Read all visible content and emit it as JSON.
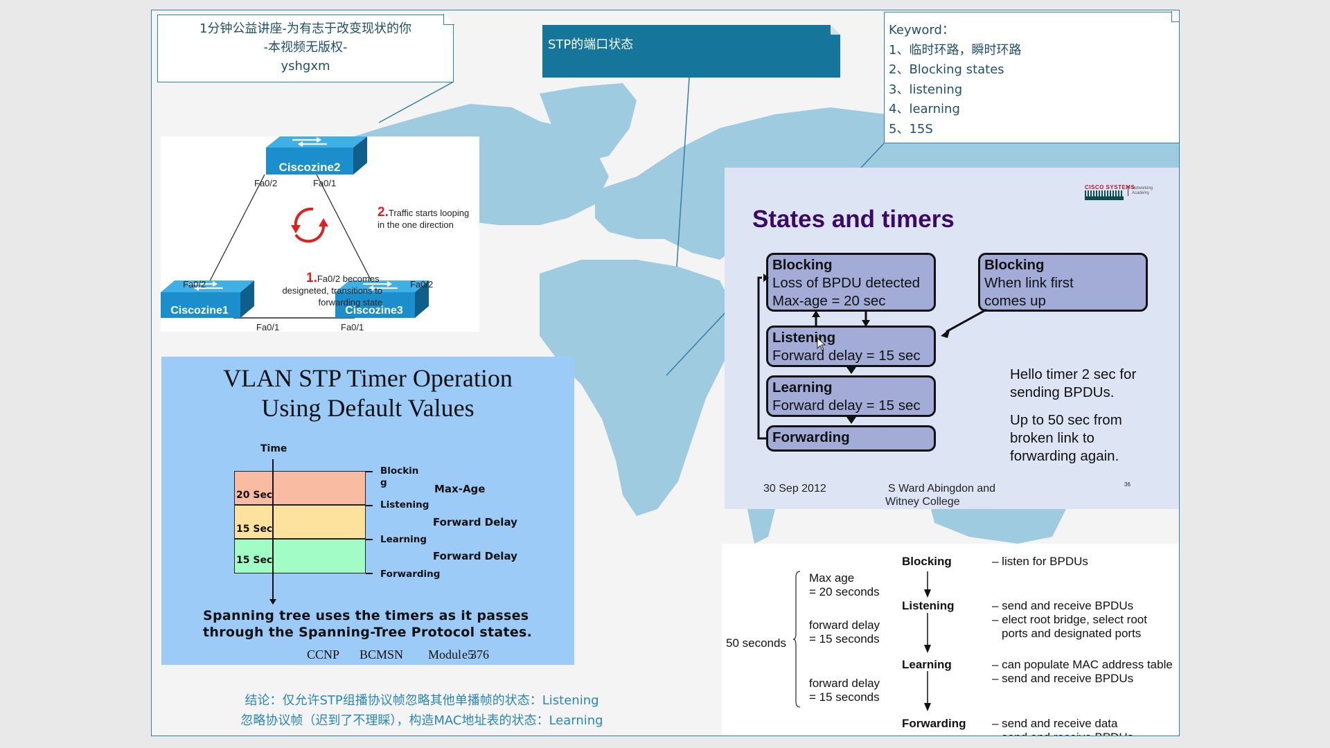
{
  "colors": {
    "slide_border": "#2f7fa8",
    "map_land": "#9fcbe0",
    "callout_title_bg": "#16759a",
    "states_title": "#3b0a64",
    "state_box": "#a2acd6",
    "vlan_bg": "#9ccbf8",
    "band_blocking": "#f9bba2",
    "band_listening": "#fde29d",
    "band_learning": "#a2fcc6",
    "conclusion_text": "#2a86b8"
  },
  "callouts": {
    "header_note": {
      "line1": "1分钟公益讲座-为有志于改变现状的你",
      "line2": "-本视频无版权-",
      "line3": "yshgxm"
    },
    "topic": {
      "title": "STP的端口状态"
    },
    "keywords": {
      "heading": "Keyword：",
      "items": [
        "1、临时环路，瞬时环路",
        "2、Blocking  states",
        "3、listening",
        "4、learning",
        "5、15S"
      ]
    }
  },
  "network_diagram": {
    "switches": [
      "Ciscozine2",
      "Ciscozine1",
      "Ciscozine3"
    ],
    "ports": {
      "sw2_left": "Fa0/2",
      "sw2_right": "Fa0/1",
      "sw1_top": "Fa0/2",
      "sw1_right": "Fa0/1",
      "sw3_top": "Fa0/2",
      "sw3_left": "Fa0/1"
    },
    "step1_num": "1.",
    "step1_lines": [
      "Fa0/2 becomes",
      "designeted, transitions to",
      "forwarding state"
    ],
    "step2_num": "2.",
    "step2_lines": [
      "Traffic starts looping",
      "in the one direction"
    ]
  },
  "vlan_slide": {
    "title_line1": "VLAN STP Timer Operation",
    "title_line2": "Using Default Values",
    "time_label": "Time",
    "bands": [
      {
        "duration": "20 Sec",
        "color": "#f9bba2",
        "timer": "Max-Age"
      },
      {
        "duration": "15 Sec",
        "color": "#fde29d",
        "timer": "Forward Delay"
      },
      {
        "duration": "15 Sec",
        "color": "#a2fcc6",
        "timer": "Forward Delay"
      }
    ],
    "state_labels": [
      "Blockin",
      "g",
      "Listening",
      "Learning",
      "Forwarding"
    ],
    "footer_line1": "Spanning tree uses the timers as it passes",
    "footer_line2": "through the Spanning-Tree Protocol states.",
    "cite": [
      "CCNP",
      "BCMSN",
      "Modul",
      "e5",
      "376"
    ]
  },
  "states_slide": {
    "logo_top": "CISCO SYSTEMS",
    "logo_right": [
      "Networking",
      "Academy"
    ],
    "title": "States and timers",
    "boxes": [
      {
        "name": "Blocking",
        "lines": [
          "Loss of BPDU detected",
          "Max-age = 20 sec"
        ]
      },
      {
        "name": "Blocking",
        "lines": [
          "When link first",
          "comes up"
        ]
      },
      {
        "name": "Listening",
        "lines": [
          "Forward delay = 15 sec"
        ]
      },
      {
        "name": "Learning",
        "lines": [
          "Forward delay = 15 sec"
        ]
      },
      {
        "name": "Forwarding",
        "lines": []
      }
    ],
    "note1": [
      "Hello timer 2 sec for",
      "sending BPDUs."
    ],
    "note2": [
      "Up to 50 sec from",
      "broken link to",
      "forwarding again."
    ],
    "date": "30 Sep 2012",
    "author": [
      "S Ward  Abingdon and",
      "Witney College"
    ],
    "page": "36"
  },
  "timeline_figure": {
    "total": "50 seconds",
    "timers": [
      [
        "Max age",
        "= 20 seconds"
      ],
      [
        "forward delay",
        "= 15 seconds"
      ],
      [
        "forward delay",
        "= 15 seconds"
      ]
    ],
    "states": [
      {
        "name": "Blocking",
        "notes": [
          "– listen for BPDUs"
        ]
      },
      {
        "name": "Listening",
        "notes": [
          "– send and receive BPDUs",
          "– elect root bridge, select root",
          "ports and designated ports"
        ]
      },
      {
        "name": "Learning",
        "notes": [
          "– can populate MAC address table",
          "– send and receive BPDUs"
        ]
      },
      {
        "name": "Forwarding",
        "notes": [
          "– send and receive data",
          "– send and receive BPDUs"
        ]
      }
    ]
  },
  "conclusion": {
    "line1": "结论：仅允许STP组播协议帧忽略其他单播帧的状态：Listening",
    "line2": "忽略协议帧（迟到了不理睬），构造MAC地址表的状态：Learning"
  }
}
